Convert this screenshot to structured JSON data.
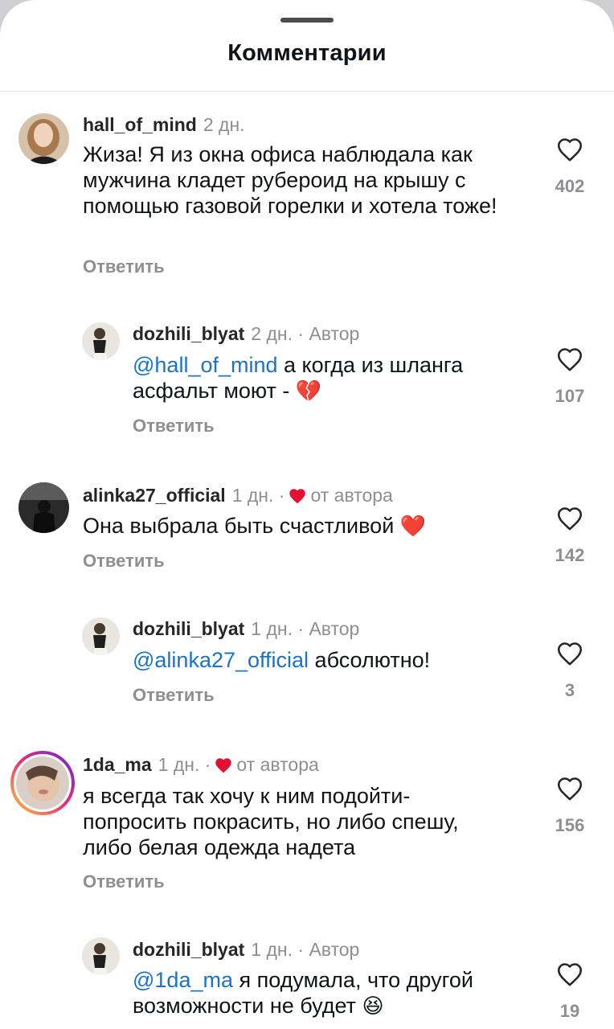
{
  "header": {
    "title": "Комментарии"
  },
  "comments": [
    {
      "user": "hall_of_mind",
      "time": "2 дн.",
      "text": "Жиза! Я из окна офиса наблюдала как мужчина кладет рубероид на крышу с помощью газовой горелки и хотела тоже!",
      "reply": "Ответить",
      "likes": "402"
    },
    {
      "user": "dozhili_blyat",
      "time": "2 дн.",
      "author": "· Автор",
      "mention": "@hall_of_mind",
      "text": " а когда из шланга асфальт моют - ",
      "emoji": "💔",
      "reply": "Ответить",
      "likes": "107"
    },
    {
      "user": "alinka27_official",
      "time": "1 дн. ·",
      "from_author": "от автора",
      "text": "Она выбрала быть счастливой ",
      "emoji": "❤️",
      "reply": "Ответить",
      "likes": "142"
    },
    {
      "user": "dozhili_blyat",
      "time": "1 дн.",
      "author": "· Автор",
      "mention": "@alinka27_official",
      "text": " абсолютно!",
      "reply": "Ответить",
      "likes": "3"
    },
    {
      "user": "1da_ma",
      "time": "1 дн. ·",
      "from_author": "от автора",
      "text": "я всегда так хочу к ним подойти-попросить покрасить, но либо спешу, либо белая одежда надета",
      "reply": "Ответить",
      "likes": "156"
    },
    {
      "user": "dozhili_blyat",
      "time": "1 дн.",
      "author": "· Автор",
      "mention": "@1da_ma",
      "text": " я подумала, что другой возможности не будет ",
      "emoji": "😆",
      "likes": "19"
    }
  ],
  "colors": {
    "mention": "#1a73c8",
    "heart": "#e5102f",
    "muted": "#8e8e93"
  },
  "icons": {
    "like": "heart-outline-icon",
    "liked_by_author": "heart-filled-icon"
  }
}
